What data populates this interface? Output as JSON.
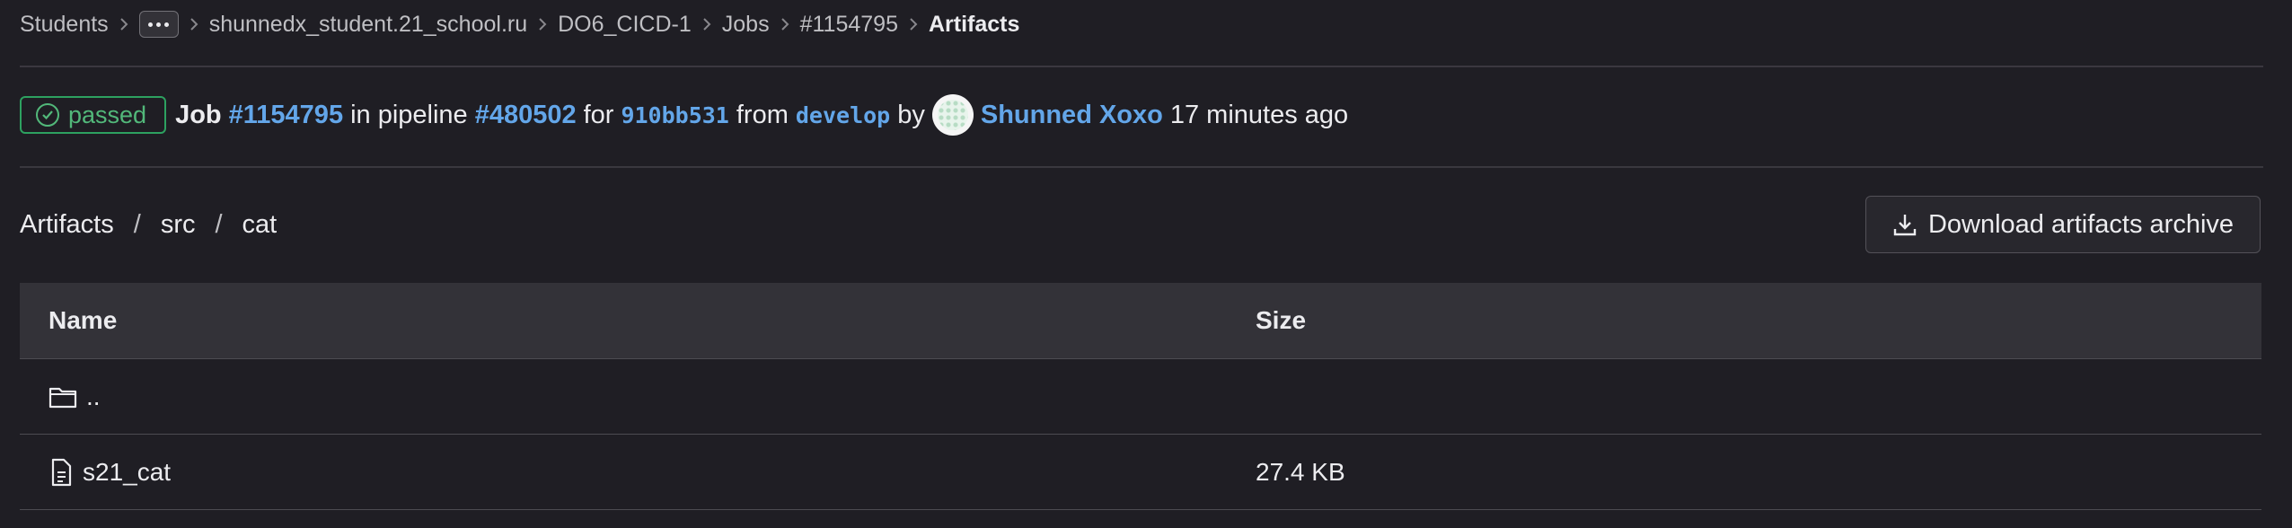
{
  "breadcrumb": {
    "items": [
      "Students",
      "shunnedx_student.21_school.ru",
      "DO6_CICD-1",
      "Jobs",
      "#1154795"
    ],
    "current": "Artifacts"
  },
  "job": {
    "status": "passed",
    "job_label": "Job",
    "job_id": "#1154795",
    "in_pipeline": "in pipeline",
    "pipeline_id": "#480502",
    "for_word": "for",
    "commit": "910bb531",
    "from_word": "from",
    "branch": "develop",
    "by_word": "by",
    "author": "Shunned Xoxo",
    "time": "17 minutes ago"
  },
  "path": {
    "segments": [
      "Artifacts",
      "src",
      "cat"
    ],
    "separator": "/"
  },
  "download_label": "Download artifacts archive",
  "table": {
    "headers": {
      "name": "Name",
      "size": "Size"
    },
    "rows": [
      {
        "name": "..",
        "size": "",
        "icon": "folder-icon"
      },
      {
        "name": "s21_cat",
        "size": "27.4 KB",
        "icon": "file-icon"
      }
    ]
  },
  "colors": {
    "background": "#1f1e24",
    "link": "#63a6e9",
    "success": "#2da160"
  }
}
